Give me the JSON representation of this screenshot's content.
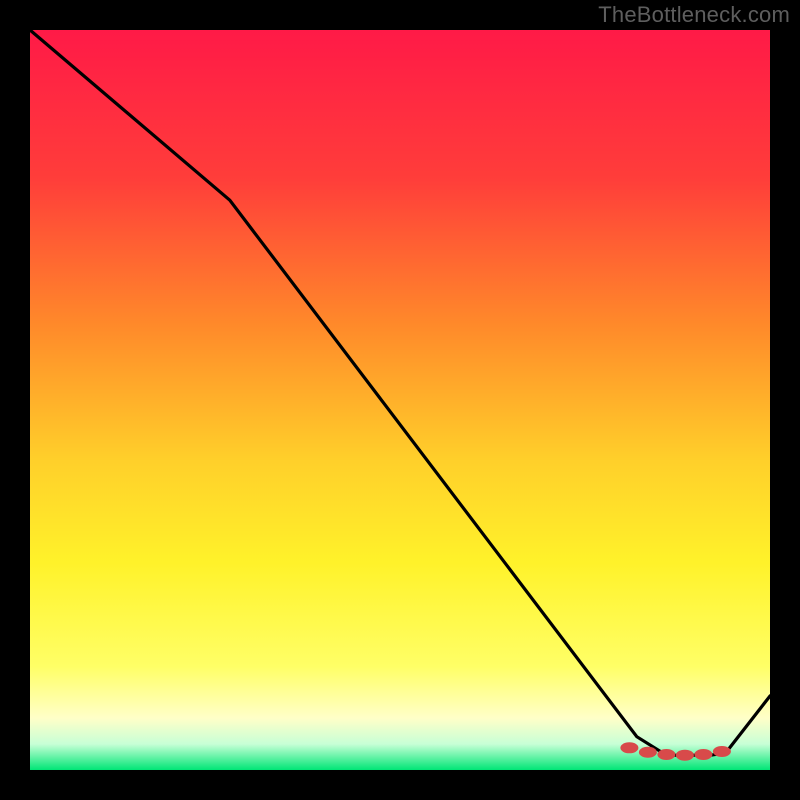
{
  "watermark": "TheBottleneck.com",
  "chart_data": {
    "type": "line",
    "title": "",
    "xlabel": "",
    "ylabel": "",
    "xlim": [
      0,
      100
    ],
    "ylim": [
      0,
      100
    ],
    "series": [
      {
        "name": "curve",
        "x": [
          0,
          27,
          82,
          86,
          92,
          94,
          100
        ],
        "values": [
          100,
          77,
          4.5,
          2.0,
          2.0,
          2.3,
          10
        ]
      }
    ],
    "markers": {
      "name": "highlight-dots",
      "x": [
        81,
        83.5,
        86,
        88.5,
        91,
        93.5
      ],
      "values": [
        3.0,
        2.4,
        2.1,
        2.0,
        2.1,
        2.5
      ]
    },
    "gradient_stops": [
      {
        "offset": 0.0,
        "color": "#ff1a47"
      },
      {
        "offset": 0.2,
        "color": "#ff3d3a"
      },
      {
        "offset": 0.4,
        "color": "#ff8a2a"
      },
      {
        "offset": 0.58,
        "color": "#ffcf2a"
      },
      {
        "offset": 0.72,
        "color": "#fff22a"
      },
      {
        "offset": 0.86,
        "color": "#ffff66"
      },
      {
        "offset": 0.93,
        "color": "#ffffc8"
      },
      {
        "offset": 0.965,
        "color": "#c7ffd6"
      },
      {
        "offset": 1.0,
        "color": "#00e676"
      }
    ]
  }
}
